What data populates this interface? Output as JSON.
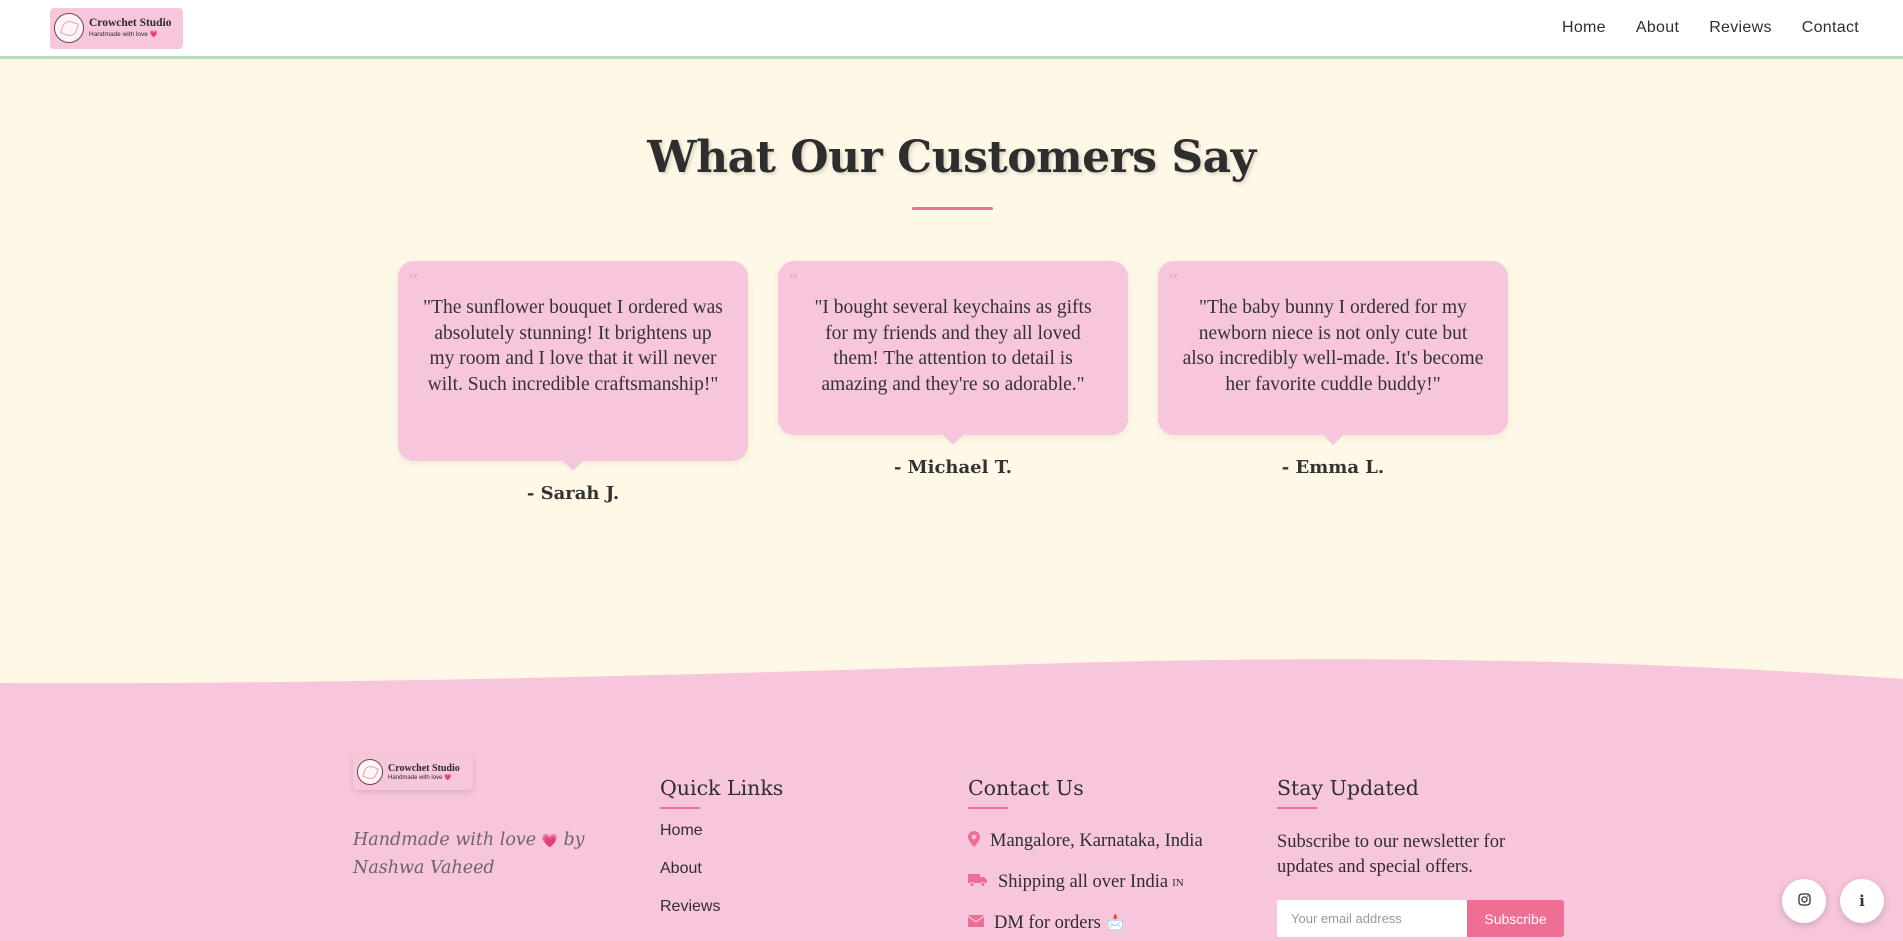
{
  "header": {
    "logo_title": "Crowchet Studio",
    "logo_sub": "Handmade with love",
    "logo_heart": "💗",
    "nav": [
      "Home",
      "About",
      "Reviews",
      "Contact"
    ]
  },
  "reviews": {
    "title": "What Our Customers Say",
    "quote_mark": "“",
    "items": [
      {
        "text": "\"The sunflower bouquet I ordered was absolutely stunning! It brightens up my room and I love that it will never wilt. Such incredible craftsmanship!\"",
        "author": "- Sarah J."
      },
      {
        "text": "\"I bought several keychains as gifts for my friends and they all loved them! The attention to detail is amazing and they're so adorable.\"",
        "author": "- Michael T."
      },
      {
        "text": "\"The baby bunny I ordered for my newborn niece is not only cute but also incredibly well-made. It's become her favorite cuddle buddy!\"",
        "author": "- Emma L."
      }
    ]
  },
  "footer": {
    "logo_title": "Crowchet Studio",
    "logo_sub": "Handmade with love",
    "logo_heart": "💗",
    "tagline_pre": "Handmade with love",
    "tagline_heart": "💗",
    "tagline_post": "by Nashwa Vaheed",
    "quick_links": {
      "heading": "Quick Links",
      "items": [
        "Home",
        "About",
        "Reviews"
      ]
    },
    "contact": {
      "heading": "Contact Us",
      "location": "Mangalore, Karnataka, India",
      "shipping": "Shipping all over India",
      "shipping_flag": "IN",
      "dm": "DM for orders",
      "dm_emoji": "📩"
    },
    "newsletter": {
      "heading": "Stay Updated",
      "text": "Subscribe to our newsletter for updates and special offers.",
      "placeholder": "Your email address",
      "button": "Subscribe"
    }
  },
  "fabs": {
    "instagram_icon": "instagram-icon",
    "info_label": "i"
  },
  "colors": {
    "accent": "#ee6f93",
    "pink": "#f7c6dc",
    "cream": "#fff8e6"
  }
}
